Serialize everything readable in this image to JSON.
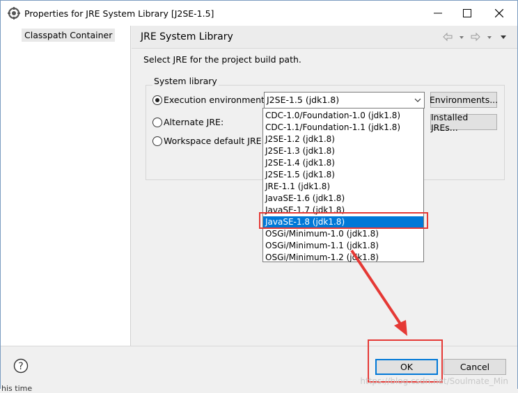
{
  "window": {
    "title": "Properties for JRE System Library [J2SE-1.5]"
  },
  "sidebar": {
    "items": [
      {
        "label": "Classpath Container"
      }
    ]
  },
  "page": {
    "title": "JRE System Library",
    "prompt": "Select JRE for the project build path."
  },
  "system_library": {
    "legend": "System library",
    "radios": [
      {
        "label": "Execution environment:",
        "checked": true
      },
      {
        "label": "Alternate JRE:",
        "checked": false
      },
      {
        "label": "Workspace default JRE (j",
        "checked": false
      }
    ],
    "combo_value": "J2SE-1.5 (jdk1.8)",
    "environments_button": "Environments...",
    "installed_jres_button": "Installed JREs..."
  },
  "dropdown": {
    "options": [
      "CDC-1.0/Foundation-1.0 (jdk1.8)",
      "CDC-1.1/Foundation-1.1 (jdk1.8)",
      "J2SE-1.2 (jdk1.8)",
      "J2SE-1.3 (jdk1.8)",
      "J2SE-1.4 (jdk1.8)",
      "J2SE-1.5 (jdk1.8)",
      "JRE-1.1 (jdk1.8)",
      "JavaSE-1.6 (jdk1.8)",
      "JavaSE-1.7 (jdk1.8)",
      "JavaSE-1.8 (jdk1.8)",
      "OSGi/Minimum-1.0 (jdk1.8)",
      "OSGi/Minimum-1.1 (jdk1.8)",
      "OSGi/Minimum-1.2 (jdk1.8)"
    ],
    "selected_index": 9
  },
  "footer": {
    "ok_label": "OK",
    "cancel_label": "Cancel"
  },
  "watermark": "https://blog.csdn.net/Soulmate_Min",
  "background_fragment": "his time",
  "colors": {
    "accent": "#0078d7",
    "annotation": "#e53935"
  }
}
